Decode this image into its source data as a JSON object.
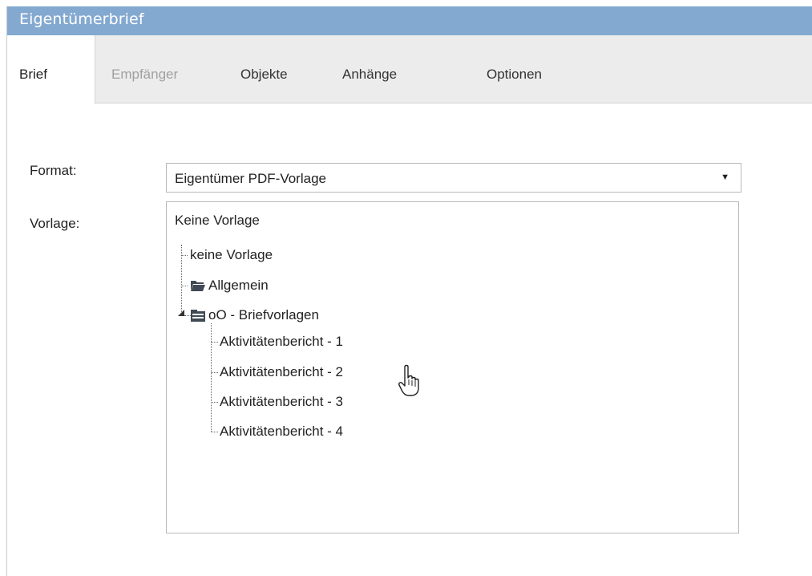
{
  "window": {
    "title": "Eigentümerbrief"
  },
  "tabs": [
    {
      "label": "Brief",
      "state": "active"
    },
    {
      "label": "Empfänger",
      "state": "disabled"
    },
    {
      "label": "Objekte",
      "state": "normal"
    },
    {
      "label": "Anhänge",
      "state": "normal"
    },
    {
      "label": "Optionen",
      "state": "normal"
    }
  ],
  "form": {
    "format_label": "Format:",
    "format_value": "Eigentümer PDF-Vorlage",
    "format_arrow": "▼",
    "vorlage_label": "Vorlage:"
  },
  "tree": {
    "selected_text": "Keine Vorlage",
    "nodes": [
      {
        "label": "keine Vorlage"
      },
      {
        "label": "Allgemein",
        "icon": "folder-open-icon"
      },
      {
        "label": "oO - Briefvorlagen",
        "icon": "template-folder-icon",
        "expanded": true
      },
      {
        "label": "Aktivitätenbericht - 1"
      },
      {
        "label": "Aktivitätenbericht - 2"
      },
      {
        "label": "Aktivitätenbericht - 3"
      },
      {
        "label": "Aktivitätenbericht - 4"
      }
    ]
  },
  "colors": {
    "titlebar": "#83a9d0",
    "tabbar": "#ececec",
    "disabled_text": "#a0a0a0"
  }
}
